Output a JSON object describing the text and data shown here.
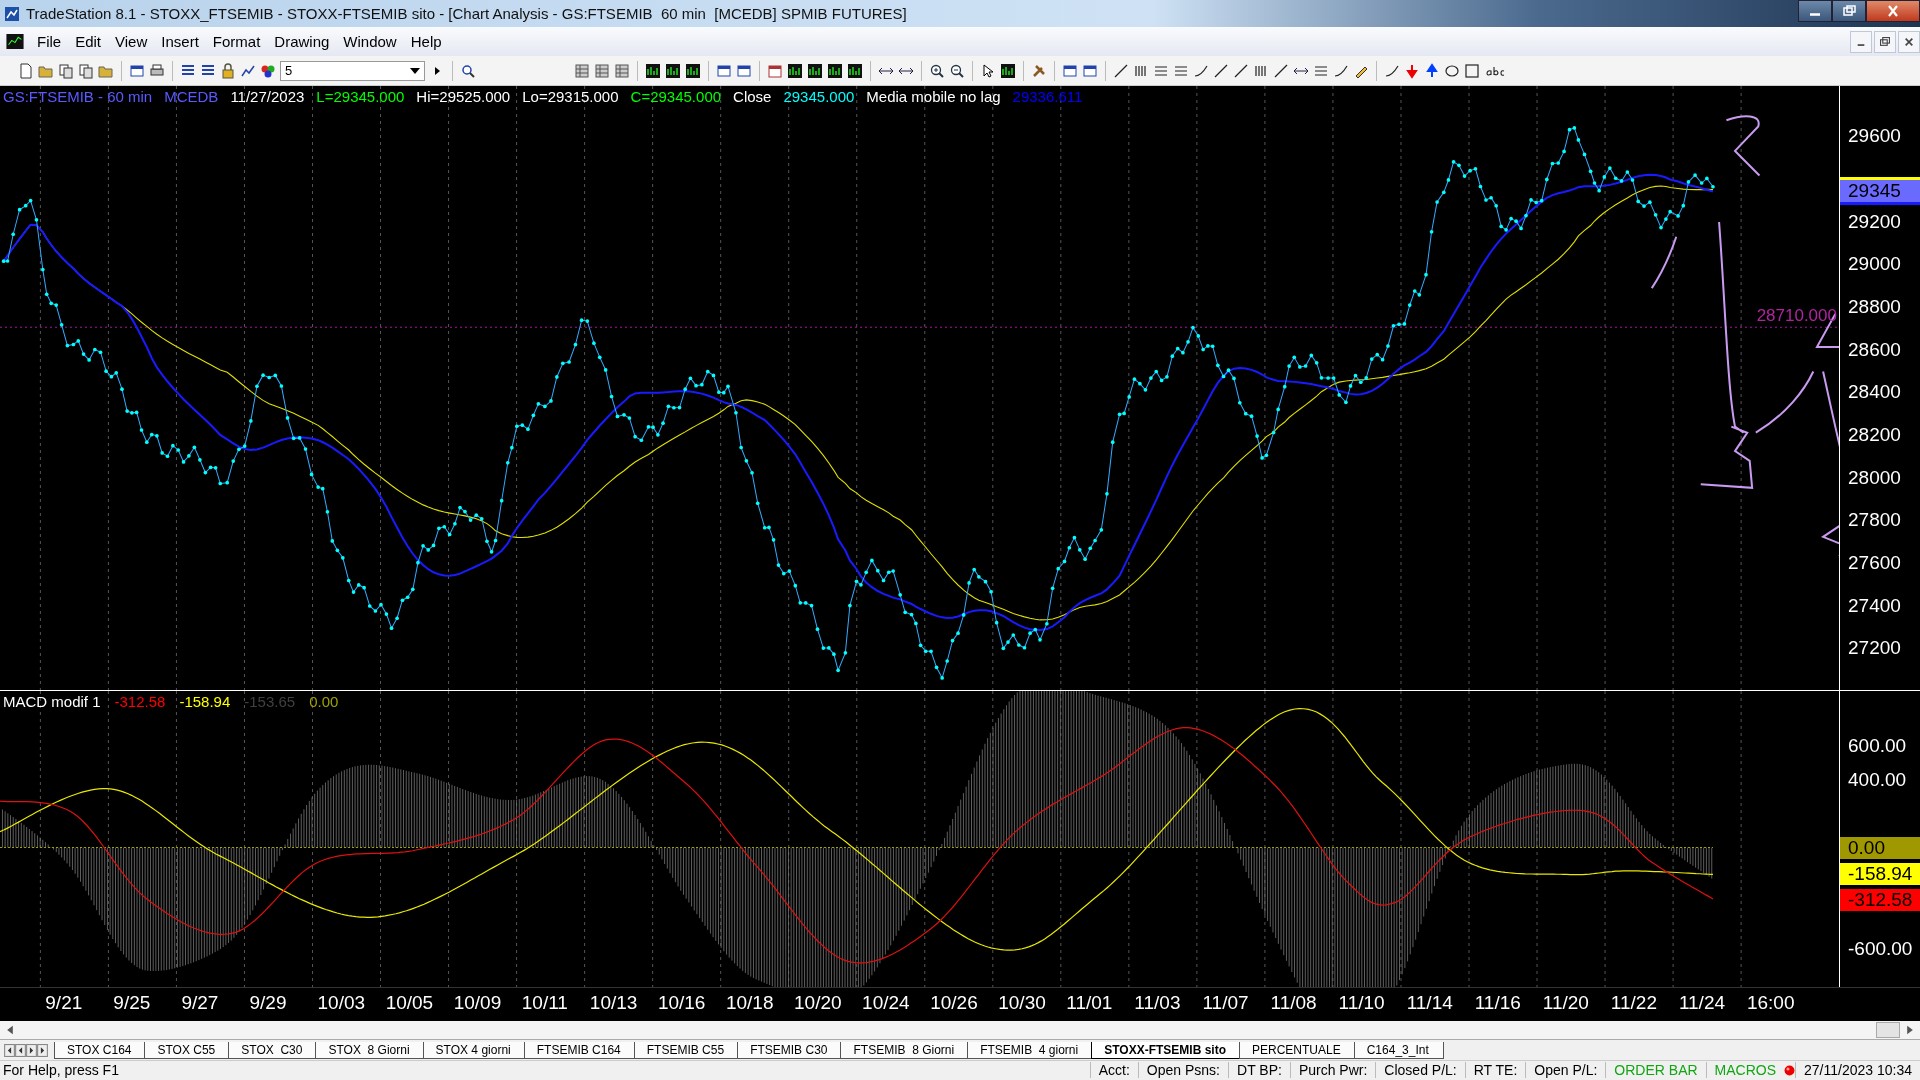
{
  "window": {
    "title": "TradeStation 8.1 - STOXX_FTSEMIB - STOXX-FTSEMIB sito - [Chart Analysis - GS:FTSEMIB  60 min  [MCEDB] SPMIB FUTURES]"
  },
  "menu": [
    "File",
    "Edit",
    "View",
    "Insert",
    "Format",
    "Drawing",
    "Window",
    "Help"
  ],
  "toolbar": {
    "dropdown_value": "5"
  },
  "price_pane": {
    "legend": [
      {
        "text": "GS:FTSEMIB - 60 min",
        "color": "#5a5aff"
      },
      {
        "text": "MCEDB",
        "color": "#5a5aff"
      },
      {
        "text": "11/27/2023",
        "color": "#ffffff"
      },
      {
        "text": "L=29345.000",
        "color": "#00ff00"
      },
      {
        "text": "Hi=29525.000",
        "color": "#ffffff"
      },
      {
        "text": "Lo=29315.000",
        "color": "#ffffff"
      },
      {
        "text": "C=29345.000",
        "color": "#00ff00"
      },
      {
        "text": "Close",
        "color": "#ffffff"
      },
      {
        "text": "29345.000",
        "color": "#00ffff"
      },
      {
        "text": "Media mobile no lag",
        "color": "#ffffff"
      },
      {
        "text": "29336.611",
        "color": "#0000ff"
      }
    ],
    "axis_ticks": [
      "29600",
      "29200",
      "29000",
      "28800",
      "28600",
      "28400",
      "28200",
      "28000",
      "27800",
      "27600",
      "27400",
      "27200"
    ],
    "last_price_tag": "29345",
    "reference_line": {
      "label": "28710.000"
    }
  },
  "macd_pane": {
    "legend": [
      {
        "text": "MACD modif 1",
        "color": "#ffffff"
      },
      {
        "text": "-312.58",
        "color": "#ff0000"
      },
      {
        "text": "-158.94",
        "color": "#ffff00"
      },
      {
        "text": "-153.65",
        "color": "#404040"
      },
      {
        "text": "0.00",
        "color": "#a0a000"
      }
    ],
    "axis_ticks": [
      "600.00",
      "400.00",
      "-600.00"
    ],
    "value_badges": [
      {
        "text": "0.00",
        "color": "#a09800"
      },
      {
        "text": "-158.94",
        "color": "#ffff00"
      },
      {
        "text": "-312.58",
        "color": "#ff0000"
      }
    ]
  },
  "x_axis": [
    "9/21",
    "9/25",
    "9/27",
    "9/29",
    "10/03",
    "10/05",
    "10/09",
    "10/11",
    "10/13",
    "10/16",
    "10/18",
    "10/20",
    "10/24",
    "10/26",
    "10/30",
    "11/01",
    "11/03",
    "11/07",
    "11/08",
    "11/10",
    "11/14",
    "11/16",
    "11/20",
    "11/22",
    "11/24",
    "16:00"
  ],
  "sheet_tabs": [
    {
      "label": "STOX C164",
      "selected": false
    },
    {
      "label": "STOX C55",
      "selected": false
    },
    {
      "label": "STOX  C30",
      "selected": false
    },
    {
      "label": "STOX  8 Giorni",
      "selected": false
    },
    {
      "label": "STOX 4 giorni",
      "selected": false
    },
    {
      "label": "FTSEMIB C164",
      "selected": false
    },
    {
      "label": "FTSEMIB C55",
      "selected": false
    },
    {
      "label": "FTSEMIB C30",
      "selected": false
    },
    {
      "label": "FTSEMIB  8 Giorni",
      "selected": false
    },
    {
      "label": "FTSEMIB  4 giorni",
      "selected": false
    },
    {
      "label": "STOXX-FTSEMIB sito",
      "selected": true
    },
    {
      "label": "PERCENTUALE",
      "selected": false
    },
    {
      "label": "C164_3_Int",
      "selected": false
    }
  ],
  "status_bar": {
    "help": "For Help, press F1",
    "fields": [
      {
        "text": "Acct:",
        "kind": "field"
      },
      {
        "text": "Open Psns:",
        "kind": "field"
      },
      {
        "text": "DT BP:",
        "kind": "field"
      },
      {
        "text": "Purch Pwr:",
        "kind": "field"
      },
      {
        "text": "Closed P/L:",
        "kind": "field"
      },
      {
        "text": "RT TE:",
        "kind": "field"
      },
      {
        "text": "Open P/L:",
        "kind": "field"
      },
      {
        "text": "ORDER BAR",
        "kind": "toggle"
      },
      {
        "text": "MACROS",
        "kind": "toggle"
      }
    ],
    "time": "27/11/2023 10:34"
  }
}
